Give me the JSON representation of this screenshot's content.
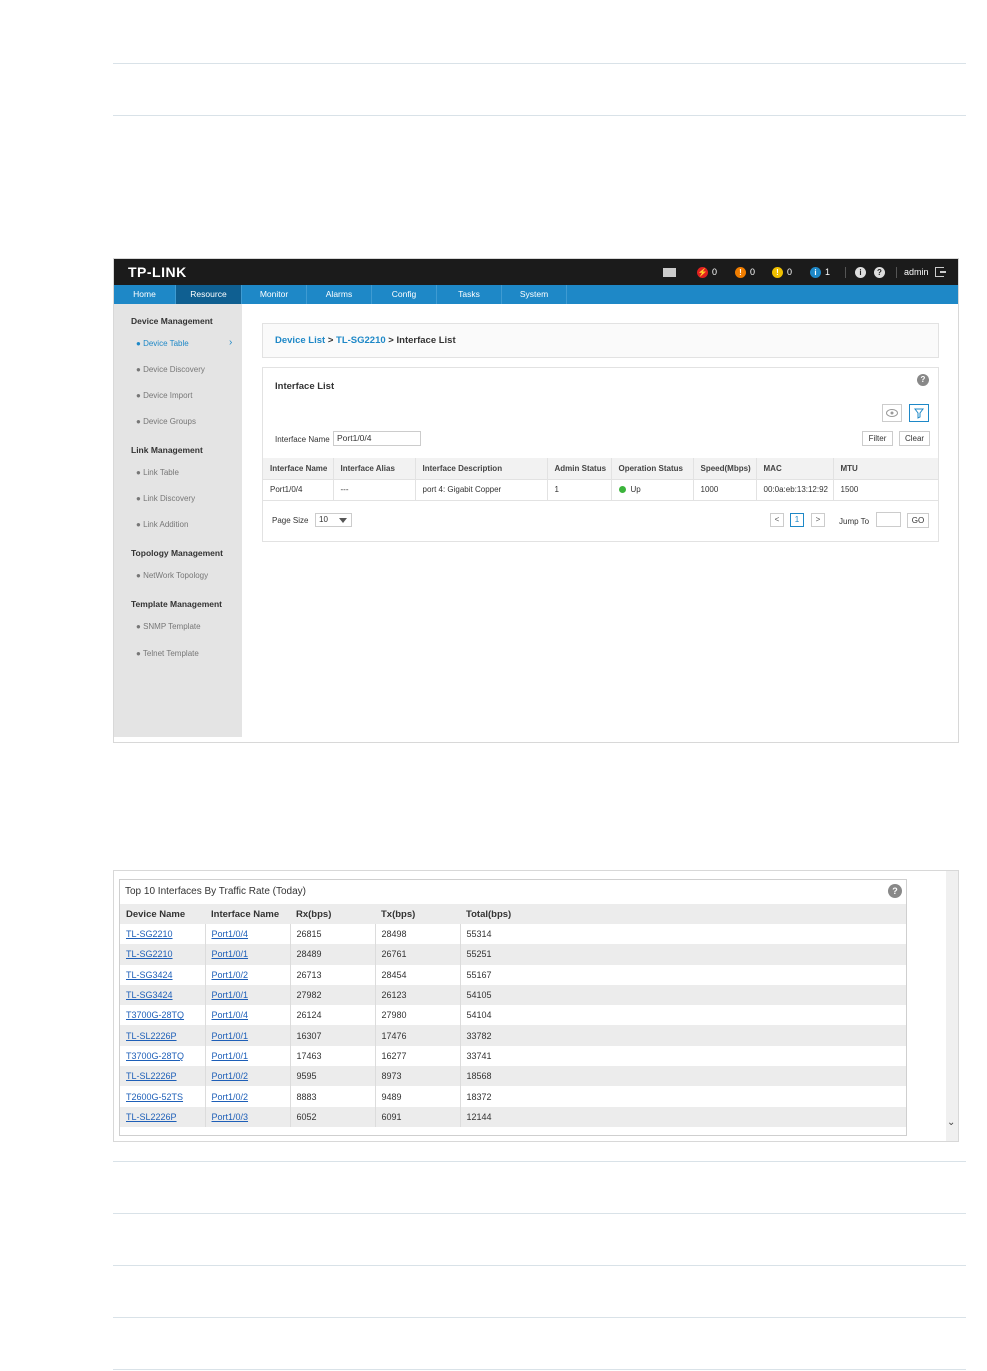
{
  "shot1": {
    "logo": "TP-LINK",
    "alarms": [
      {
        "color": "#e02020",
        "glyph": "⚡",
        "count": "0"
      },
      {
        "color": "#f07d00",
        "glyph": "!",
        "count": "0"
      },
      {
        "color": "#f0c000",
        "glyph": "!",
        "count": "0"
      },
      {
        "color": "#1e88c7",
        "glyph": "i",
        "count": "1"
      }
    ],
    "user": "admin",
    "nav_tabs": [
      "Home",
      "Resource",
      "Monitor",
      "Alarms",
      "Config",
      "Tasks",
      "System"
    ],
    "active_tab": "Resource",
    "sidebar": {
      "device_management": "Device Management",
      "device_items": [
        "Device Table",
        "Device Discovery",
        "Device Import",
        "Device Groups"
      ],
      "link_management": "Link Management",
      "link_items": [
        "Link Table",
        "Link Discovery",
        "Link Addition"
      ],
      "topology_management": "Topology Management",
      "topology_items": [
        "NetWork Topology"
      ],
      "template_management": "Template Management",
      "template_items": [
        "SNMP Template",
        "Telnet Template"
      ]
    },
    "breadcrumb": {
      "device_list": "Device List",
      "sep": ">",
      "device": "TL-SG2210",
      "current": "Interface List"
    },
    "panel": {
      "title": "Interface List",
      "filter_label": "Interface Name",
      "filter_value": "Port1/0/4",
      "filter_button": "Filter",
      "clear_button": "Clear",
      "columns": [
        "Interface Name",
        "Interface Alias",
        "Interface Description",
        "Admin Status",
        "Operation Status",
        "Speed(Mbps)",
        "MAC",
        "MTU"
      ],
      "row": {
        "name": "Port1/0/4",
        "alias": "---",
        "description": "port 4: Gigabit Copper",
        "admin_status": "1",
        "operation_status": "Up",
        "speed": "1000",
        "mac": "00:0a:eb:13:12:92",
        "mtu": "1500"
      },
      "page_size_label": "Page Size",
      "page_size_value": "10",
      "prev": "<",
      "current_page": "1",
      "next": ">",
      "jump_label": "Jump To",
      "go_button": "GO"
    }
  },
  "shot2": {
    "title": "Top 10 Interfaces By Traffic Rate (Today)",
    "columns": [
      "Device Name",
      "Interface Name",
      "Rx(bps)",
      "Tx(bps)",
      "Total(bps)"
    ],
    "rows": [
      {
        "device": "TL-SG2210",
        "iface": "Port1/0/4",
        "rx": "26815",
        "tx": "28498",
        "total": "55314"
      },
      {
        "device": "TL-SG2210",
        "iface": "Port1/0/1",
        "rx": "28489",
        "tx": "26761",
        "total": "55251"
      },
      {
        "device": "TL-SG3424",
        "iface": "Port1/0/2",
        "rx": "26713",
        "tx": "28454",
        "total": "55167"
      },
      {
        "device": "TL-SG3424",
        "iface": "Port1/0/1",
        "rx": "27982",
        "tx": "26123",
        "total": "54105"
      },
      {
        "device": "T3700G-28TQ",
        "iface": "Port1/0/4",
        "rx": "26124",
        "tx": "27980",
        "total": "54104"
      },
      {
        "device": "TL-SL2226P",
        "iface": "Port1/0/1",
        "rx": "16307",
        "tx": "17476",
        "total": "33782"
      },
      {
        "device": "T3700G-28TQ",
        "iface": "Port1/0/1",
        "rx": "17463",
        "tx": "16277",
        "total": "33741"
      },
      {
        "device": "TL-SL2226P",
        "iface": "Port1/0/2",
        "rx": "9595",
        "tx": "8973",
        "total": "18568"
      },
      {
        "device": "T2600G-52TS",
        "iface": "Port1/0/2",
        "rx": "8883",
        "tx": "9489",
        "total": "18372"
      },
      {
        "device": "TL-SL2226P",
        "iface": "Port1/0/3",
        "rx": "6052",
        "tx": "6091",
        "total": "12144"
      }
    ]
  }
}
